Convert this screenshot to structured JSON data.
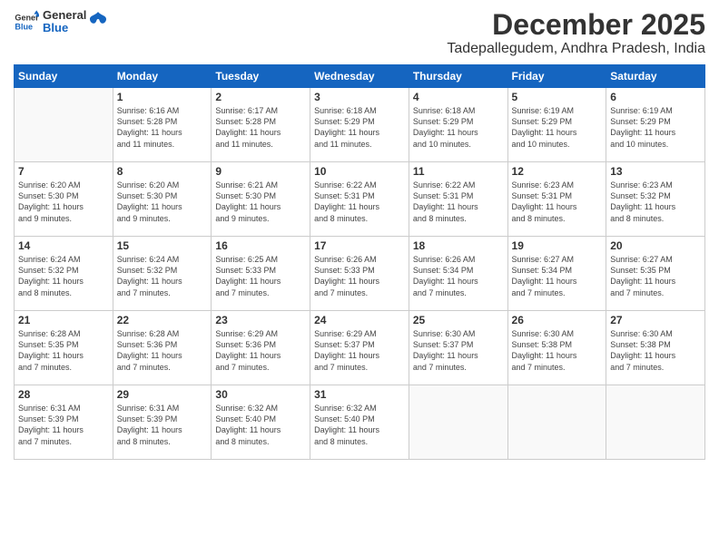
{
  "logo": {
    "line1": "General",
    "line2": "Blue"
  },
  "title": "December 2025",
  "location": "Tadepallegudem, Andhra Pradesh, India",
  "days": [
    "Sunday",
    "Monday",
    "Tuesday",
    "Wednesday",
    "Thursday",
    "Friday",
    "Saturday"
  ],
  "weeks": [
    [
      {
        "num": "",
        "text": ""
      },
      {
        "num": "1",
        "text": "Sunrise: 6:16 AM\nSunset: 5:28 PM\nDaylight: 11 hours\nand 11 minutes."
      },
      {
        "num": "2",
        "text": "Sunrise: 6:17 AM\nSunset: 5:28 PM\nDaylight: 11 hours\nand 11 minutes."
      },
      {
        "num": "3",
        "text": "Sunrise: 6:18 AM\nSunset: 5:29 PM\nDaylight: 11 hours\nand 11 minutes."
      },
      {
        "num": "4",
        "text": "Sunrise: 6:18 AM\nSunset: 5:29 PM\nDaylight: 11 hours\nand 10 minutes."
      },
      {
        "num": "5",
        "text": "Sunrise: 6:19 AM\nSunset: 5:29 PM\nDaylight: 11 hours\nand 10 minutes."
      },
      {
        "num": "6",
        "text": "Sunrise: 6:19 AM\nSunset: 5:29 PM\nDaylight: 11 hours\nand 10 minutes."
      }
    ],
    [
      {
        "num": "7",
        "text": "Sunrise: 6:20 AM\nSunset: 5:30 PM\nDaylight: 11 hours\nand 9 minutes."
      },
      {
        "num": "8",
        "text": "Sunrise: 6:20 AM\nSunset: 5:30 PM\nDaylight: 11 hours\nand 9 minutes."
      },
      {
        "num": "9",
        "text": "Sunrise: 6:21 AM\nSunset: 5:30 PM\nDaylight: 11 hours\nand 9 minutes."
      },
      {
        "num": "10",
        "text": "Sunrise: 6:22 AM\nSunset: 5:31 PM\nDaylight: 11 hours\nand 8 minutes."
      },
      {
        "num": "11",
        "text": "Sunrise: 6:22 AM\nSunset: 5:31 PM\nDaylight: 11 hours\nand 8 minutes."
      },
      {
        "num": "12",
        "text": "Sunrise: 6:23 AM\nSunset: 5:31 PM\nDaylight: 11 hours\nand 8 minutes."
      },
      {
        "num": "13",
        "text": "Sunrise: 6:23 AM\nSunset: 5:32 PM\nDaylight: 11 hours\nand 8 minutes."
      }
    ],
    [
      {
        "num": "14",
        "text": "Sunrise: 6:24 AM\nSunset: 5:32 PM\nDaylight: 11 hours\nand 8 minutes."
      },
      {
        "num": "15",
        "text": "Sunrise: 6:24 AM\nSunset: 5:32 PM\nDaylight: 11 hours\nand 7 minutes."
      },
      {
        "num": "16",
        "text": "Sunrise: 6:25 AM\nSunset: 5:33 PM\nDaylight: 11 hours\nand 7 minutes."
      },
      {
        "num": "17",
        "text": "Sunrise: 6:26 AM\nSunset: 5:33 PM\nDaylight: 11 hours\nand 7 minutes."
      },
      {
        "num": "18",
        "text": "Sunrise: 6:26 AM\nSunset: 5:34 PM\nDaylight: 11 hours\nand 7 minutes."
      },
      {
        "num": "19",
        "text": "Sunrise: 6:27 AM\nSunset: 5:34 PM\nDaylight: 11 hours\nand 7 minutes."
      },
      {
        "num": "20",
        "text": "Sunrise: 6:27 AM\nSunset: 5:35 PM\nDaylight: 11 hours\nand 7 minutes."
      }
    ],
    [
      {
        "num": "21",
        "text": "Sunrise: 6:28 AM\nSunset: 5:35 PM\nDaylight: 11 hours\nand 7 minutes."
      },
      {
        "num": "22",
        "text": "Sunrise: 6:28 AM\nSunset: 5:36 PM\nDaylight: 11 hours\nand 7 minutes."
      },
      {
        "num": "23",
        "text": "Sunrise: 6:29 AM\nSunset: 5:36 PM\nDaylight: 11 hours\nand 7 minutes."
      },
      {
        "num": "24",
        "text": "Sunrise: 6:29 AM\nSunset: 5:37 PM\nDaylight: 11 hours\nand 7 minutes."
      },
      {
        "num": "25",
        "text": "Sunrise: 6:30 AM\nSunset: 5:37 PM\nDaylight: 11 hours\nand 7 minutes."
      },
      {
        "num": "26",
        "text": "Sunrise: 6:30 AM\nSunset: 5:38 PM\nDaylight: 11 hours\nand 7 minutes."
      },
      {
        "num": "27",
        "text": "Sunrise: 6:30 AM\nSunset: 5:38 PM\nDaylight: 11 hours\nand 7 minutes."
      }
    ],
    [
      {
        "num": "28",
        "text": "Sunrise: 6:31 AM\nSunset: 5:39 PM\nDaylight: 11 hours\nand 7 minutes."
      },
      {
        "num": "29",
        "text": "Sunrise: 6:31 AM\nSunset: 5:39 PM\nDaylight: 11 hours\nand 8 minutes."
      },
      {
        "num": "30",
        "text": "Sunrise: 6:32 AM\nSunset: 5:40 PM\nDaylight: 11 hours\nand 8 minutes."
      },
      {
        "num": "31",
        "text": "Sunrise: 6:32 AM\nSunset: 5:40 PM\nDaylight: 11 hours\nand 8 minutes."
      },
      {
        "num": "",
        "text": ""
      },
      {
        "num": "",
        "text": ""
      },
      {
        "num": "",
        "text": ""
      }
    ]
  ]
}
